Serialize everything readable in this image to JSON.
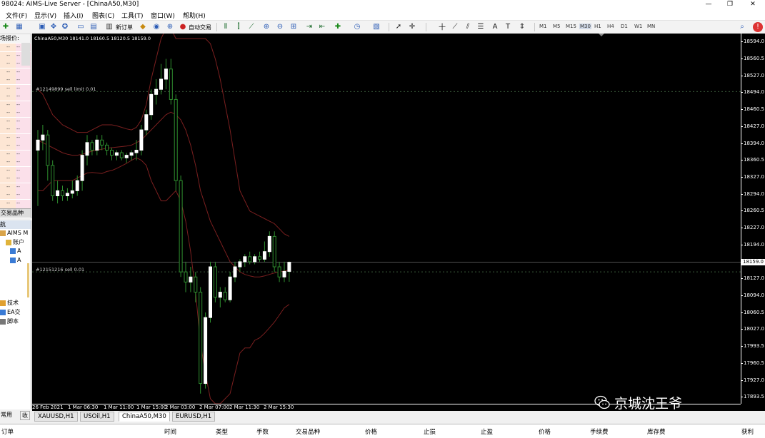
{
  "window": {
    "title": "98024: AIMS-Live Server - [ChinaA50,M30]",
    "min": "—",
    "max": "❐",
    "close": "✕"
  },
  "menu": [
    "文件(F)",
    "显示(V)",
    "插入(I)",
    "图表(C)",
    "工具(T)",
    "窗口(W)",
    "帮助(H)"
  ],
  "toolbar": {
    "new_order": "新订单",
    "auto_trading": "自动交易",
    "timeframes": [
      "M1",
      "M5",
      "M15",
      "M30",
      "H1",
      "H4",
      "D1",
      "W1",
      "MN"
    ],
    "active_timeframe": "M30"
  },
  "market_watch": {
    "title": "场报价:",
    "rows": [
      "--",
      "--",
      "--",
      "--",
      "--",
      "--",
      "--",
      "--",
      "--",
      "--",
      "--",
      "--",
      "--",
      "--",
      "--",
      "--",
      "--",
      "--",
      "--",
      "--",
      "--"
    ],
    "tab": "交易品种"
  },
  "navigator": {
    "title": "航",
    "items": [
      {
        "label": "AIMS M",
        "icon": "terminal-icon"
      },
      {
        "label": "账户",
        "icon": "accounts-icon"
      },
      {
        "label": "A",
        "icon": "account-icon"
      },
      {
        "label": "A",
        "icon": "account-icon"
      },
      {
        "label": "技术",
        "icon": "indicators-icon"
      },
      {
        "label": "EA交",
        "icon": "experts-icon"
      },
      {
        "label": "脚本",
        "icon": "scripts-icon"
      }
    ],
    "tabs": [
      "常用",
      "收"
    ]
  },
  "chart": {
    "symbol_line": "ChinaA50,M30  18141.0 18160.5 18120.5 18159.0",
    "current_price": "18159.0",
    "orders": [
      {
        "label": "#12149899 sell limit 0.01",
        "price": 18495.5
      },
      {
        "label": "#12151216 sell 0.01",
        "price": 18140.0
      }
    ],
    "y_ticks": [
      "18594.0",
      "18560.5",
      "18527.0",
      "18494.0",
      "18460.5",
      "18427.0",
      "18394.0",
      "18360.5",
      "18327.0",
      "18294.0",
      "18260.5",
      "18227.0",
      "18194.0",
      "18159.0",
      "18127.0",
      "18094.0",
      "18060.5",
      "18027.0",
      "17993.5",
      "17960.5",
      "17927.0",
      "17893.5"
    ],
    "x_ticks": [
      "26 Feb 2021",
      "1 Mar 06:30",
      "1 Mar 11:00",
      "1 Mar 15:00",
      "2 Mar 03:00",
      "2 Mar 07:00",
      "2 Mar 11:30",
      "2 Mar 15:30"
    ],
    "watermark": "京城沈王爷",
    "colors": {
      "background": "#000000",
      "bull": "#ffffff",
      "bear": "#2f8f2f",
      "bands": "#7a1f1f",
      "grid_line": "#3a5a3a"
    }
  },
  "chart_data": {
    "type": "candlestick",
    "ylim": [
      17880,
      18610
    ],
    "candles": [
      {
        "o": 18380,
        "h": 18420,
        "l": 18270,
        "c": 18400
      },
      {
        "o": 18400,
        "h": 18430,
        "l": 18380,
        "c": 18410
      },
      {
        "o": 18410,
        "h": 18420,
        "l": 18320,
        "c": 18350
      },
      {
        "o": 18350,
        "h": 18360,
        "l": 18280,
        "c": 18290
      },
      {
        "o": 18290,
        "h": 18320,
        "l": 18275,
        "c": 18300
      },
      {
        "o": 18300,
        "h": 18310,
        "l": 18280,
        "c": 18290
      },
      {
        "o": 18290,
        "h": 18305,
        "l": 18280,
        "c": 18295
      },
      {
        "o": 18295,
        "h": 18320,
        "l": 18285,
        "c": 18300
      },
      {
        "o": 18300,
        "h": 18330,
        "l": 18290,
        "c": 18320
      },
      {
        "o": 18320,
        "h": 18380,
        "l": 18300,
        "c": 18370
      },
      {
        "o": 18370,
        "h": 18410,
        "l": 18350,
        "c": 18395
      },
      {
        "o": 18395,
        "h": 18400,
        "l": 18370,
        "c": 18380
      },
      {
        "o": 18380,
        "h": 18410,
        "l": 18370,
        "c": 18400
      },
      {
        "o": 18400,
        "h": 18410,
        "l": 18380,
        "c": 18390
      },
      {
        "o": 18390,
        "h": 18395,
        "l": 18370,
        "c": 18380
      },
      {
        "o": 18380,
        "h": 18385,
        "l": 18360,
        "c": 18370
      },
      {
        "o": 18370,
        "h": 18380,
        "l": 18360,
        "c": 18375
      },
      {
        "o": 18375,
        "h": 18380,
        "l": 18360,
        "c": 18365
      },
      {
        "o": 18365,
        "h": 18375,
        "l": 18355,
        "c": 18370
      },
      {
        "o": 18370,
        "h": 18380,
        "l": 18360,
        "c": 18375
      },
      {
        "o": 18375,
        "h": 18400,
        "l": 18360,
        "c": 18380
      },
      {
        "o": 18380,
        "h": 18430,
        "l": 18370,
        "c": 18420
      },
      {
        "o": 18420,
        "h": 18460,
        "l": 18410,
        "c": 18450
      },
      {
        "o": 18450,
        "h": 18500,
        "l": 18440,
        "c": 18490
      },
      {
        "o": 18490,
        "h": 18520,
        "l": 18470,
        "c": 18500
      },
      {
        "o": 18500,
        "h": 18550,
        "l": 18490,
        "c": 18520
      },
      {
        "o": 18520,
        "h": 18560,
        "l": 18500,
        "c": 18540
      },
      {
        "o": 18540,
        "h": 18560,
        "l": 18470,
        "c": 18480
      },
      {
        "o": 18480,
        "h": 18490,
        "l": 18300,
        "c": 18320
      },
      {
        "o": 18320,
        "h": 18330,
        "l": 18130,
        "c": 18140
      },
      {
        "o": 18140,
        "h": 18160,
        "l": 18100,
        "c": 18120
      },
      {
        "o": 18120,
        "h": 18150,
        "l": 18100,
        "c": 18130
      },
      {
        "o": 18130,
        "h": 18140,
        "l": 18080,
        "c": 18100
      },
      {
        "o": 18100,
        "h": 18110,
        "l": 17900,
        "c": 17920
      },
      {
        "o": 17920,
        "h": 18060,
        "l": 17910,
        "c": 18050
      },
      {
        "o": 18050,
        "h": 18160,
        "l": 18040,
        "c": 18150
      },
      {
        "o": 18150,
        "h": 18160,
        "l": 18080,
        "c": 18090
      },
      {
        "o": 18090,
        "h": 18110,
        "l": 18070,
        "c": 18100
      },
      {
        "o": 18100,
        "h": 18110,
        "l": 18080,
        "c": 18085
      },
      {
        "o": 18085,
        "h": 18140,
        "l": 18080,
        "c": 18130
      },
      {
        "o": 18130,
        "h": 18160,
        "l": 18120,
        "c": 18150
      },
      {
        "o": 18150,
        "h": 18165,
        "l": 18140,
        "c": 18160
      },
      {
        "o": 18160,
        "h": 18175,
        "l": 18150,
        "c": 18170
      },
      {
        "o": 18170,
        "h": 18180,
        "l": 18155,
        "c": 18160
      },
      {
        "o": 18160,
        "h": 18175,
        "l": 18155,
        "c": 18170
      },
      {
        "o": 18170,
        "h": 18180,
        "l": 18160,
        "c": 18165
      },
      {
        "o": 18165,
        "h": 18200,
        "l": 18160,
        "c": 18180
      },
      {
        "o": 18180,
        "h": 18220,
        "l": 18170,
        "c": 18210
      },
      {
        "o": 18210,
        "h": 18220,
        "l": 18140,
        "c": 18150
      },
      {
        "o": 18150,
        "h": 18160,
        "l": 18120,
        "c": 18130
      },
      {
        "o": 18130,
        "h": 18160,
        "l": 18120,
        "c": 18141
      },
      {
        "o": 18141,
        "h": 18160.5,
        "l": 18120.5,
        "c": 18159
      }
    ],
    "bands": {
      "upper": [
        18500,
        18490,
        18470,
        18450,
        18440,
        18430,
        18425,
        18420,
        18415,
        18415,
        18415,
        18420,
        18425,
        18430,
        18430,
        18430,
        18428,
        18425,
        18422,
        18420,
        18425,
        18440,
        18470,
        18520,
        18560,
        18600,
        18620,
        18620,
        18600,
        18600,
        18600,
        18600,
        18600,
        18600,
        18600,
        18590,
        18560,
        18520,
        18470,
        18420,
        18360,
        18300,
        18280,
        18260,
        18255,
        18250,
        18245,
        18240,
        18235,
        18225,
        18215,
        18210
      ],
      "middle": [
        18400,
        18395,
        18390,
        18385,
        18380,
        18375,
        18372,
        18370,
        18370,
        18372,
        18375,
        18378,
        18380,
        18382,
        18384,
        18385,
        18386,
        18387,
        18388,
        18390,
        18395,
        18400,
        18410,
        18420,
        18430,
        18440,
        18450,
        18455,
        18450,
        18440,
        18420,
        18390,
        18350,
        18300,
        18270,
        18240,
        18220,
        18200,
        18180,
        18160,
        18150,
        18140,
        18135,
        18132,
        18130,
        18130,
        18132,
        18135,
        18138,
        18140,
        18142,
        18143
      ],
      "lower": [
        18300,
        18300,
        18310,
        18320,
        18320,
        18320,
        18320,
        18320,
        18325,
        18330,
        18335,
        18336,
        18335,
        18334,
        18338,
        18340,
        18344,
        18349,
        18354,
        18360,
        18365,
        18360,
        18350,
        18320,
        18300,
        18280,
        18280,
        18290,
        18300,
        18280,
        18240,
        18180,
        18100,
        18000,
        17940,
        17890,
        17880,
        17880,
        17890,
        17900,
        17940,
        17980,
        17990,
        17990,
        18005,
        18010,
        18019,
        18030,
        18041,
        18055,
        18069,
        18076
      ]
    }
  },
  "chart_tabs": [
    "XAUUSD,H1",
    "USOil,H1",
    "ChinaA50,M30",
    "EURUSD,H1"
  ],
  "active_chart_tab": "ChinaA50,M30",
  "terminal": {
    "headers": [
      "订单",
      "时间",
      "类型",
      "手数",
      "交易品种",
      "价格",
      "止损",
      "止盈",
      "价格",
      "手续费",
      "库存费",
      "获利"
    ]
  }
}
